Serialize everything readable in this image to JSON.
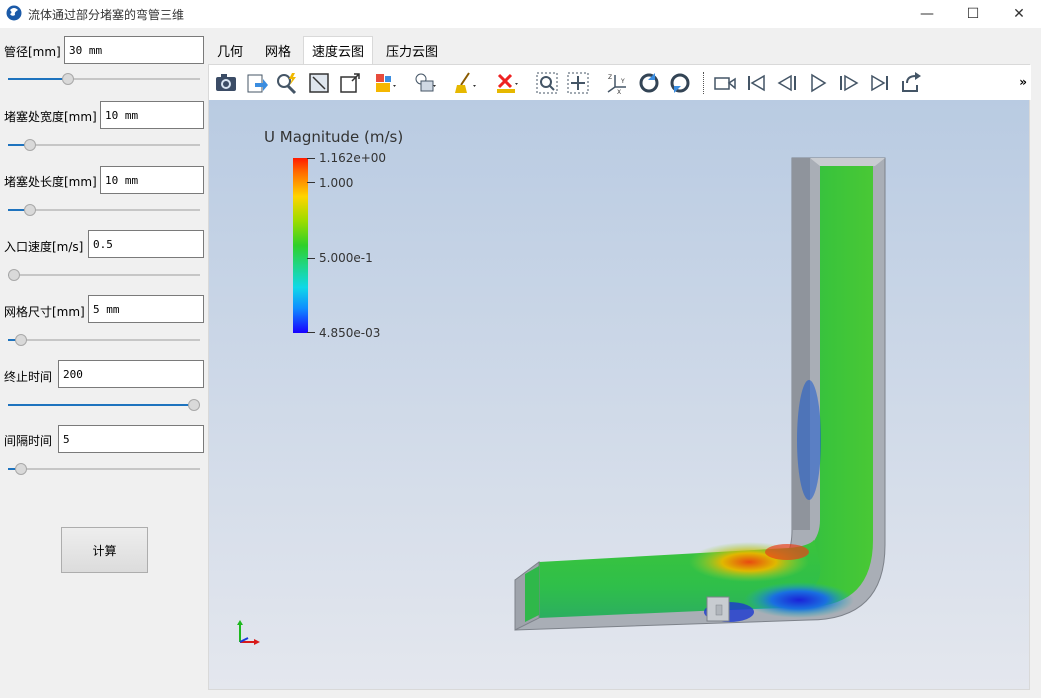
{
  "window": {
    "title": "流体通过部分堵塞的弯管三维",
    "minimize": "—",
    "maximize": "☐",
    "close": "✕"
  },
  "params": {
    "pipe_diameter": {
      "label": "管径[mm]",
      "value": "30 mm",
      "slider": 0.3
    },
    "blockage_width": {
      "label": "堵塞处宽度[mm]",
      "value": "10 mm",
      "slider": 0.09
    },
    "blockage_length": {
      "label": "堵塞处长度[mm]",
      "value": "10 mm",
      "slider": 0.09
    },
    "inlet_velocity": {
      "label": "入口速度[m/s]",
      "value": "0.5",
      "slider": 0.0
    },
    "mesh_size": {
      "label": "网格尺寸[mm]",
      "value": "5 mm",
      "slider": 0.04
    },
    "end_time": {
      "label": "终止时间",
      "value": "200",
      "slider": 1.0
    },
    "interval_time": {
      "label": "间隔时间",
      "value": "5",
      "slider": 0.04
    }
  },
  "calculate_button": "计算",
  "tabs": [
    "几何",
    "网格",
    "速度云图",
    "压力云图"
  ],
  "active_tab": "速度云图",
  "toolbar": {
    "icons": [
      "camera-icon",
      "export-icon",
      "probe-icon",
      "reset-camera-icon",
      "zoom-to-box-icon",
      "color-map-icon",
      "light-icon",
      "clear-icon",
      "delete-icon",
      "zoom-icon",
      "fit-icon",
      "axes-icon",
      "rotate-cw-icon",
      "rotate-ccw-icon",
      "record-icon",
      "first-frame-icon",
      "prev-frame-icon",
      "play-icon",
      "next-frame-icon",
      "last-frame-icon",
      "loop-icon"
    ],
    "more": "»"
  },
  "legend": {
    "title": "U Magnitude (m/s)",
    "labels": [
      "1.162e+00",
      "1.000",
      "5.000e-1",
      "4.850e-03"
    ],
    "colors": {
      "max": "#ff1a00",
      "mid": "#2fd02a",
      "min": "#1900ff"
    }
  }
}
